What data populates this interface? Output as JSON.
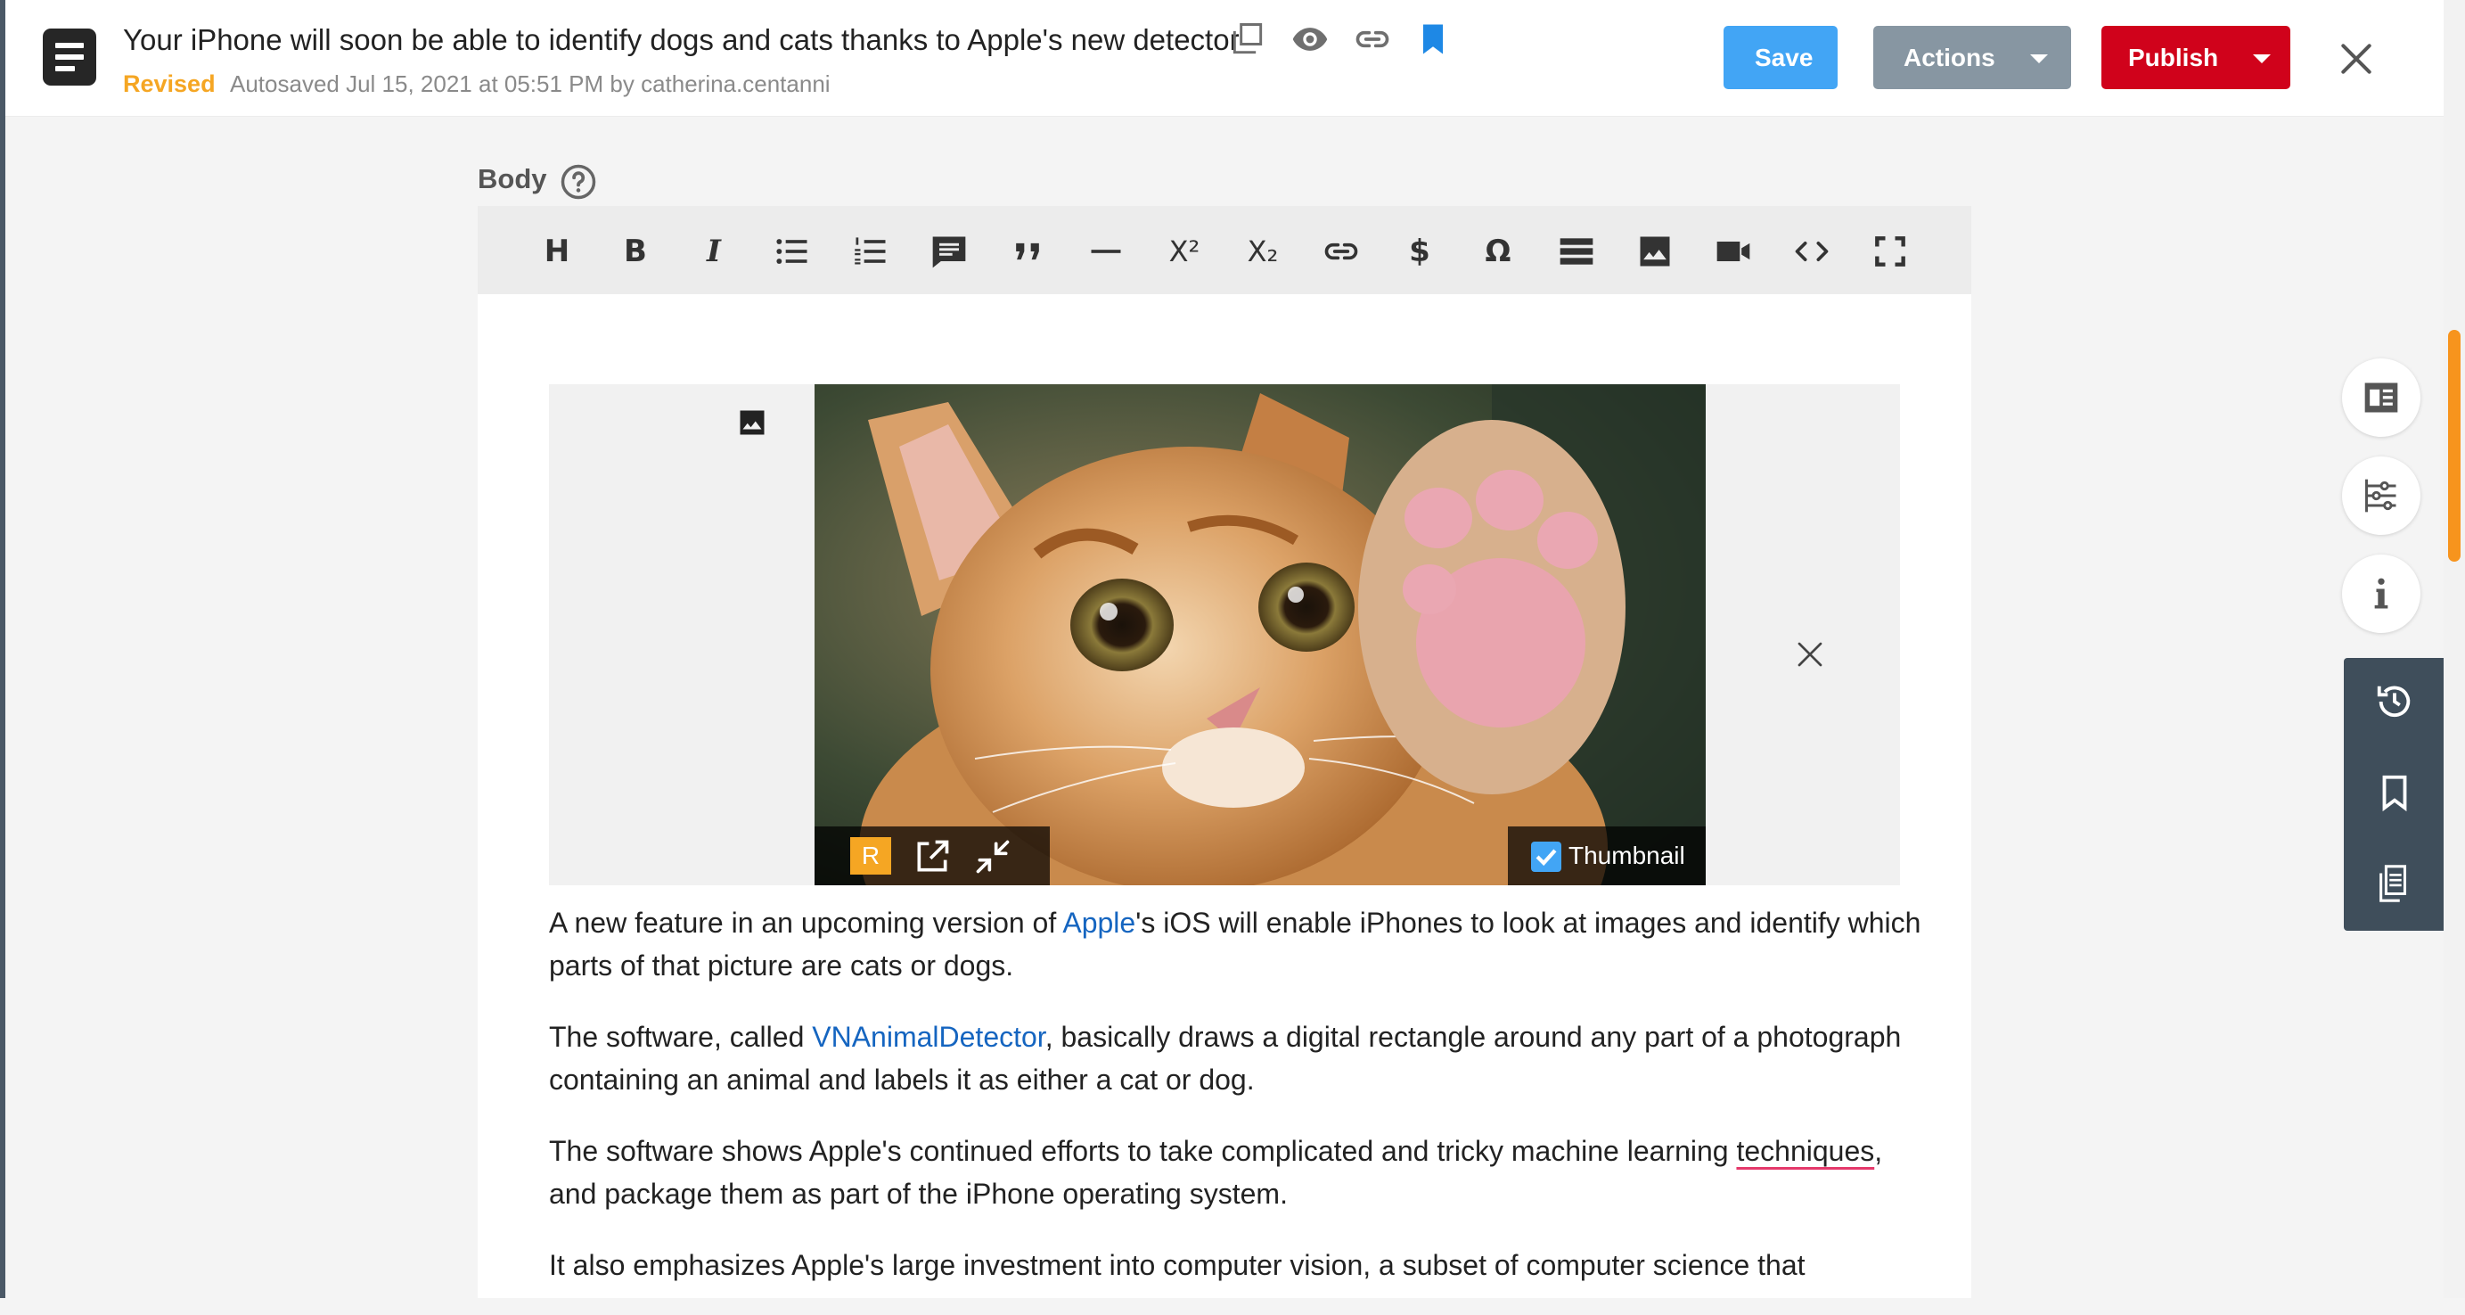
{
  "header": {
    "title": "Your iPhone will soon be able to identify dogs and cats thanks to Apple's new detector",
    "status": "Revised",
    "autosaved": "Autosaved Jul 15, 2021 at 05:51 PM by catherina.centanni",
    "icons": [
      "copy-icon",
      "preview-eye-icon",
      "link-icon",
      "bookmark-icon"
    ],
    "buttons": {
      "save": "Save",
      "actions": "Actions",
      "publish": "Publish"
    },
    "colors": {
      "save": "#42a5f5",
      "actions": "#8796a2",
      "publish": "#d0021b",
      "status": "#f5a623"
    }
  },
  "editor": {
    "label": "Body",
    "toolbar": {
      "heading": "H",
      "bold": "B",
      "italic": "I",
      "superscript": "X²",
      "subscript": "X₂",
      "currency": "$",
      "special_char": "Ω",
      "items": [
        "heading",
        "bold",
        "italic",
        "bullet-list",
        "numbered-list",
        "comment",
        "blockquote",
        "horizontal-rule",
        "superscript",
        "subscript",
        "link",
        "currency",
        "special-character",
        "divider",
        "image",
        "video",
        "code",
        "fullscreen"
      ]
    },
    "image": {
      "badge": "R",
      "thumbnail_label": "Thumbnail",
      "thumbnail_checked": true
    },
    "paragraphs": {
      "p1_before": "A new feature in an upcoming version of ",
      "p1_link": "Apple",
      "p1_after": "'s iOS will enable iPhones to look at images and identify which parts of that picture are cats or dogs.",
      "p2_before": "The software, called ",
      "p2_link": "VNAnimalDetector",
      "p2_after": ", basically draws a digital rectangle around any part of a photograph containing an animal and labels it as either a cat or dog.",
      "p3_before": "The software shows Apple's continued efforts to take complicated and tricky machine learning ",
      "p3_misspelled": "techniques",
      "p3_after": ", and package them as part of the iPhone operating system.",
      "p4": "It also emphasizes Apple's large investment into computer vision, a subset of computer science that"
    }
  },
  "rail": {
    "buttons": [
      "article-icon",
      "settings-sliders-icon",
      "info-icon"
    ],
    "panel": [
      "history-icon",
      "bookmark-outline-icon",
      "pages-icon"
    ]
  }
}
